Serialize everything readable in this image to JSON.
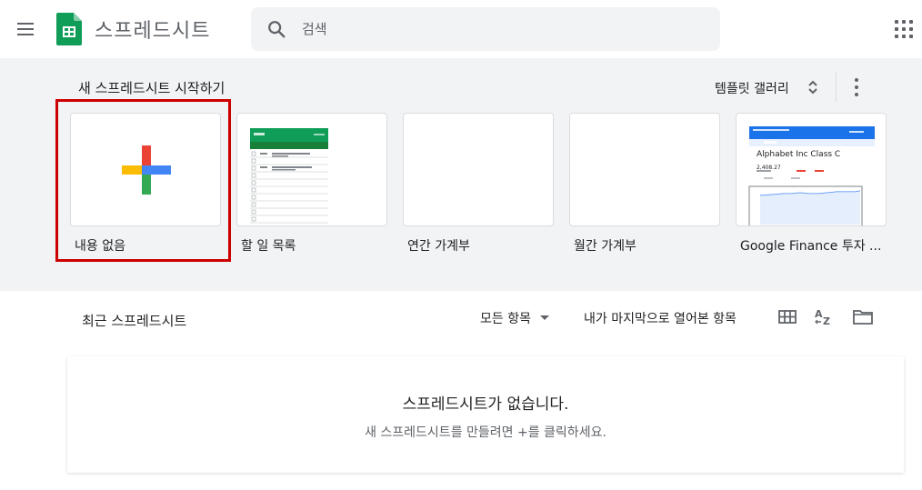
{
  "header": {
    "app_title": "스프레드시트",
    "search_placeholder": "검색",
    "menu_icon": "hamburger-menu-icon",
    "apps_icon": "google-apps-grid-icon"
  },
  "templates": {
    "title": "새 스프레드시트 시작하기",
    "gallery_label": "템플릿 갤러리",
    "items": [
      {
        "label": "내용 없음"
      },
      {
        "label": "할 일 목록"
      },
      {
        "label": "연간 가계부"
      },
      {
        "label": "월간 가계부"
      },
      {
        "label": "Google Finance 투자 ..."
      }
    ],
    "finance_preview": {
      "title": "Alphabet Inc Class C",
      "price": "2,408.27"
    }
  },
  "recent": {
    "title": "최근 스프레드시트",
    "owner_filter": "모든 항목",
    "sort_label": "내가 마지막으로 열어본 항목",
    "empty_title": "스프레드시트가 없습니다.",
    "empty_subtitle": "새 스프레드시트를 만들려면 +를 클릭하세요."
  },
  "colors": {
    "sheets_green": "#0f9d58",
    "highlight_red": "#cc0000",
    "plus_red": "#ea4335",
    "plus_blue": "#4285f4",
    "plus_yellow": "#fbbc04",
    "plus_green": "#34a853"
  }
}
